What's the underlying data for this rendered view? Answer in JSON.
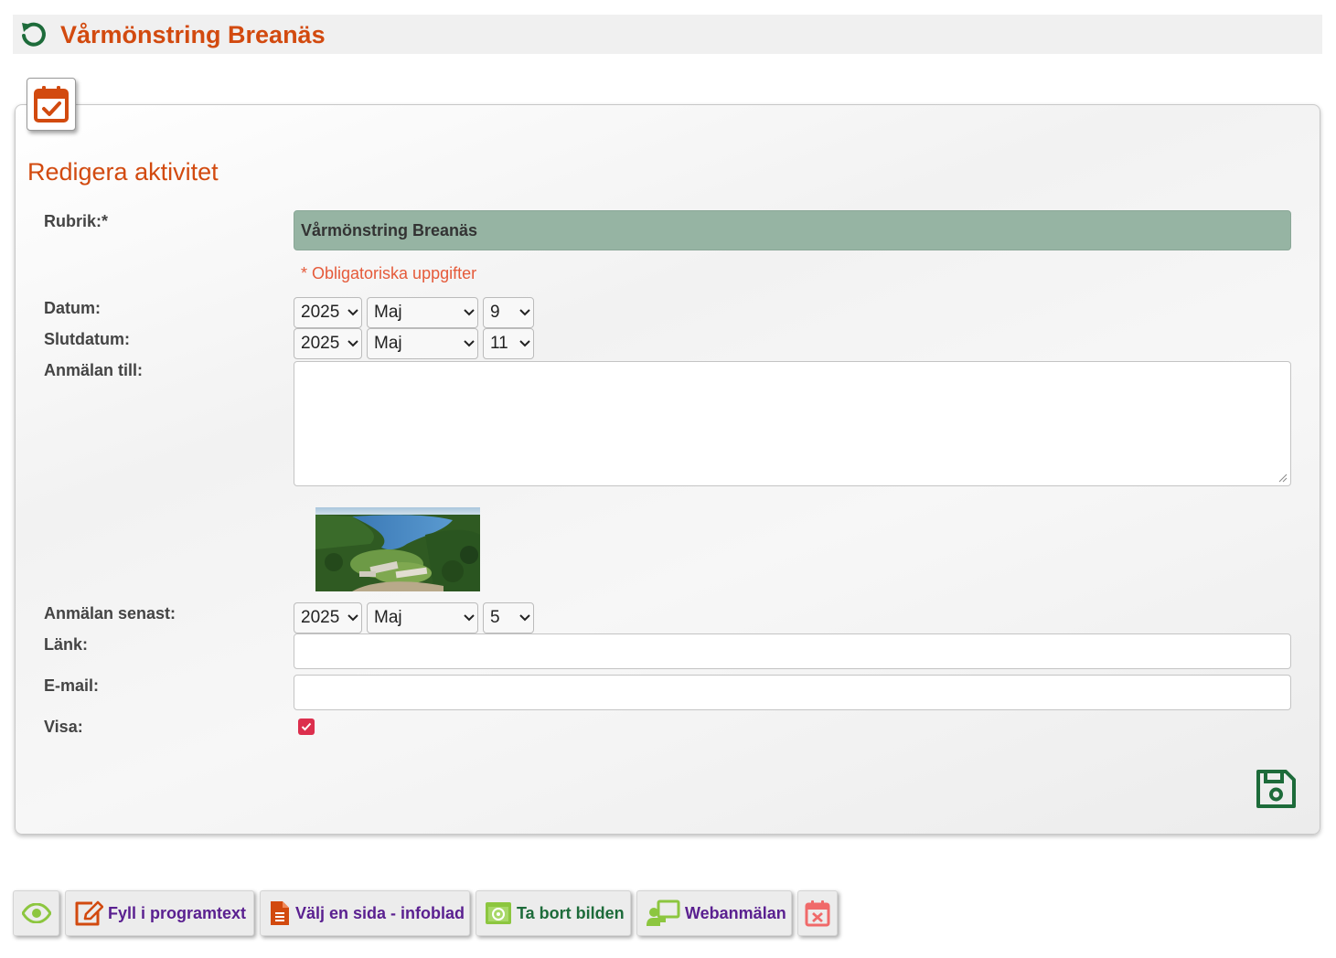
{
  "header": {
    "title": "Vårmönstring Breanäs",
    "reload_icon": "reload-icon"
  },
  "panel": {
    "title": "Redigera aktivitet",
    "badge_icon": "calendar-check-icon",
    "fields": {
      "rubrik_label": "Rubrik:*",
      "rubrik_value": "Vårmönstring Breanäs",
      "required_note": "* Obligatoriska uppgifter",
      "datum_label": "Datum:",
      "datum": {
        "year": "2025",
        "month": "Maj",
        "day": "9"
      },
      "slutdatum_label": "Slutdatum:",
      "slutdatum": {
        "year": "2025",
        "month": "Maj",
        "day": "11"
      },
      "anmalan_till_label": "Anmälan till:",
      "anmalan_till_value": "",
      "anmalan_senast_label": "Anmälan senast:",
      "anmalan_senast": {
        "year": "2025",
        "month": "Maj",
        "day": "5"
      },
      "lank_label": "Länk:",
      "lank_value": "",
      "email_label": "E-mail:",
      "email_value": "",
      "visa_label": "Visa:",
      "visa_checked": true
    },
    "photo_icon": "aerial-lake-photo",
    "save_icon": "save-icon"
  },
  "toolbar": {
    "preview_icon": "eye-icon",
    "fill_text": "Fyll i programtext",
    "choose_page": "Välj en sida - infoblad",
    "remove_image": "Ta bort bilden",
    "webanmalan": "Webanmälan",
    "delete_icon": "calendar-delete-icon"
  },
  "colors": {
    "accent": "#d24a0f",
    "brand_green": "#1d6b3a",
    "rubrik_bg": "#96b4a3",
    "checkbox": "#dc2f4d",
    "link_purple": "#5a2090"
  }
}
